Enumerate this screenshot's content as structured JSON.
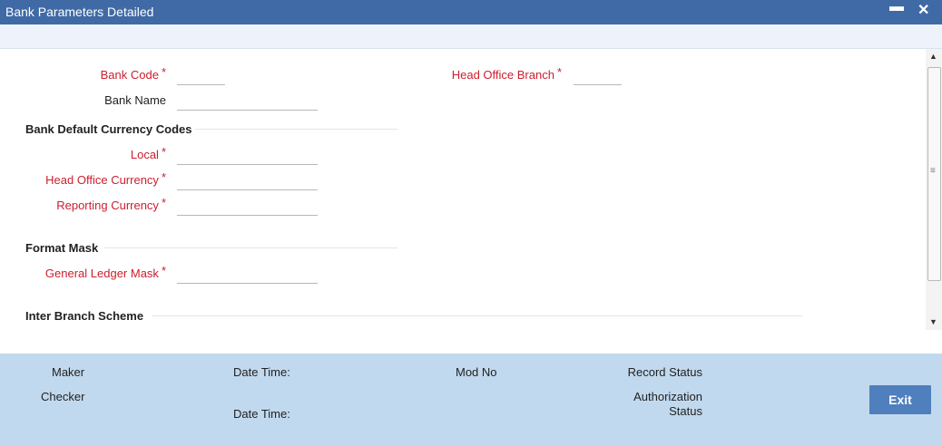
{
  "window": {
    "title": "Bank Parameters Detailed",
    "minimize_glyph": "▬",
    "close_glyph": "✕"
  },
  "form": {
    "bank_code": {
      "label": "Bank Code",
      "value": ""
    },
    "head_office_branch": {
      "label": "Head Office Branch",
      "value": ""
    },
    "bank_name": {
      "label": "Bank Name",
      "value": ""
    },
    "currency_section": {
      "title": "Bank Default Currency Codes",
      "local": {
        "label": "Local",
        "value": ""
      },
      "head_office_currency": {
        "label": "Head Office Currency",
        "value": ""
      },
      "reporting_currency": {
        "label": "Reporting Currency",
        "value": ""
      }
    },
    "format_section": {
      "title": "Format Mask",
      "gl_mask": {
        "label": "General Ledger Mask",
        "value": ""
      }
    },
    "inter_branch_section": {
      "title": "Inter Branch Scheme"
    },
    "required_marker": "*"
  },
  "footer": {
    "maker": "Maker",
    "checker": "Checker",
    "date_time_1": "Date Time:",
    "date_time_2": "Date Time:",
    "mod_no": "Mod No",
    "record_status": "Record Status",
    "authorization": "Authorization",
    "status": "Status",
    "exit_label": "Exit"
  },
  "colors": {
    "titlebar": "#3f6aa6",
    "required_label": "#cc1e2e",
    "footer_bg": "#c1d9ee",
    "exit_button": "#4f7fbd"
  }
}
